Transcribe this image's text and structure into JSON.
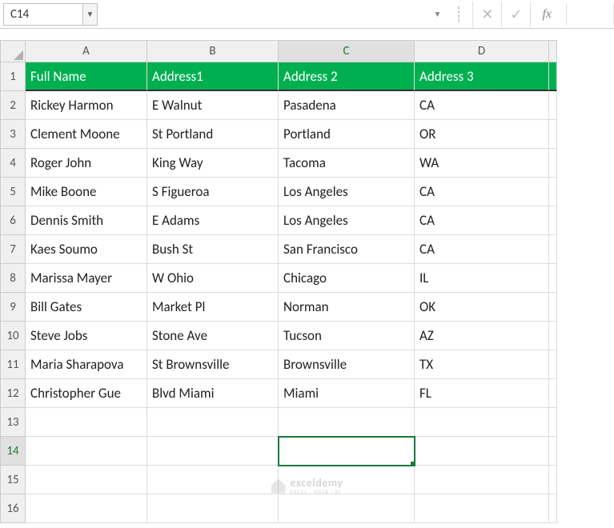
{
  "nameBox": "C14",
  "fxLabel": "fx",
  "columns": [
    "A",
    "B",
    "C",
    "D"
  ],
  "activeColumn": "C",
  "activeRow": "14",
  "activeCell": {
    "col": 2,
    "row": 13
  },
  "headers": [
    "Full Name",
    "Address1",
    "Address 2",
    "Address 3"
  ],
  "rows": [
    [
      "Rickey Harmon",
      "E Walnut",
      "Pasadena",
      "CA"
    ],
    [
      "Clement Moone",
      "St Portland",
      "Portland",
      "OR"
    ],
    [
      "Roger John",
      "King Way",
      "Tacoma",
      "WA"
    ],
    [
      "Mike Boone",
      "S Figueroa",
      "Los Angeles",
      "CA"
    ],
    [
      "Dennis Smith",
      "E Adams",
      "Los Angeles",
      "CA"
    ],
    [
      "Kaes Soumo",
      "Bush St",
      "San Francisco",
      "CA"
    ],
    [
      "Marissa Mayer",
      "W Ohio",
      "Chicago",
      "IL"
    ],
    [
      "Bill Gates",
      "Market Pl",
      "Norman",
      "OK"
    ],
    [
      "Steve Jobs",
      "Stone Ave",
      "Tucson",
      "AZ"
    ],
    [
      "Maria Sharapova",
      "St Brownsville",
      "Brownsville",
      "TX"
    ],
    [
      "Christopher Gue",
      "Blvd Miami",
      "Miami",
      "FL"
    ]
  ],
  "emptyRows": 4,
  "watermark": {
    "main": "exceldemy",
    "sub": "EXCEL · DATA · BI"
  },
  "chart_data": {
    "type": "table",
    "title": "",
    "columns": [
      "Full Name",
      "Address1",
      "Address 2",
      "Address 3"
    ],
    "data": [
      {
        "Full Name": "Rickey Harmon",
        "Address1": "E Walnut",
        "Address 2": "Pasadena",
        "Address 3": "CA"
      },
      {
        "Full Name": "Clement Moone",
        "Address1": "St Portland",
        "Address 2": "Portland",
        "Address 3": "OR"
      },
      {
        "Full Name": "Roger John",
        "Address1": "King Way",
        "Address 2": "Tacoma",
        "Address 3": "WA"
      },
      {
        "Full Name": "Mike Boone",
        "Address1": "S Figueroa",
        "Address 2": "Los Angeles",
        "Address 3": "CA"
      },
      {
        "Full Name": "Dennis Smith",
        "Address1": "E Adams",
        "Address 2": "Los Angeles",
        "Address 3": "CA"
      },
      {
        "Full Name": "Kaes Soumo",
        "Address1": "Bush St",
        "Address 2": "San Francisco",
        "Address 3": "CA"
      },
      {
        "Full Name": "Marissa Mayer",
        "Address1": "W Ohio",
        "Address 2": "Chicago",
        "Address 3": "IL"
      },
      {
        "Full Name": "Bill Gates",
        "Address1": "Market Pl",
        "Address 2": "Norman",
        "Address 3": "OK"
      },
      {
        "Full Name": "Steve Jobs",
        "Address1": "Stone Ave",
        "Address 2": "Tucson",
        "Address 3": "AZ"
      },
      {
        "Full Name": "Maria Sharapova",
        "Address1": "St Brownsville",
        "Address 2": "Brownsville",
        "Address 3": "TX"
      },
      {
        "Full Name": "Christopher Gue",
        "Address1": "Blvd Miami",
        "Address 2": "Miami",
        "Address 3": "FL"
      }
    ]
  }
}
